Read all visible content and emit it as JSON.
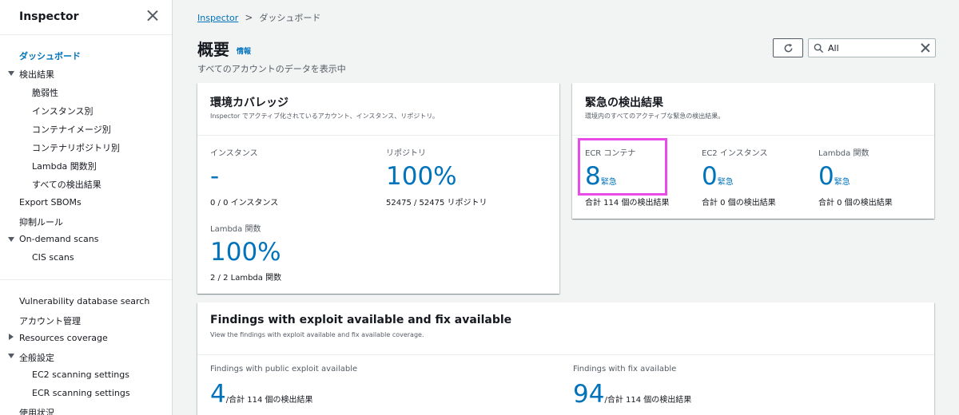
{
  "sidebar": {
    "title": "Inspector",
    "items": [
      {
        "label": "ダッシュボード"
      },
      {
        "label": "検出結果"
      },
      {
        "label": "脆弱性"
      },
      {
        "label": "インスタンス別"
      },
      {
        "label": "コンテナイメージ別"
      },
      {
        "label": "コンテナリポジトリ別"
      },
      {
        "label": "Lambda 関数別"
      },
      {
        "label": "すべての検出結果"
      },
      {
        "label": "Export SBOMs"
      },
      {
        "label": "抑制ルール"
      },
      {
        "label": "On-demand scans"
      },
      {
        "label": "CIS scans"
      },
      {
        "label": "Vulnerability database search"
      },
      {
        "label": "アカウント管理"
      },
      {
        "label": "Resources coverage"
      },
      {
        "label": "全般設定"
      },
      {
        "label": "EC2 scanning settings"
      },
      {
        "label": "ECR scanning settings"
      },
      {
        "label": "使用状況"
      }
    ]
  },
  "breadcrumb": {
    "root": "Inspector",
    "current": "ダッシュボード"
  },
  "header": {
    "title": "概要",
    "info": "情報",
    "description": "すべてのアカウントのデータを表示中"
  },
  "search": {
    "value": "All"
  },
  "coverage": {
    "title": "環境カバレッジ",
    "description": "Inspector でアクティブ化されているアカウント、インスタンス、リポジトリ。",
    "instances": {
      "label": "インスタンス",
      "value": "-",
      "sub": "0 / 0 インスタンス"
    },
    "repositories": {
      "label": "リポジトリ",
      "value": "100%",
      "sub": "52475 / 52475 リポジトリ"
    },
    "lambda": {
      "label": "Lambda 関数",
      "value": "100%",
      "sub": "2 / 2 Lambda 関数"
    }
  },
  "critical": {
    "title": "緊急の検出結果",
    "description": "環境内のすべてのアクティブな緊急の検出結果。",
    "ecr": {
      "label": "ECR コンテナ",
      "value": "8",
      "unit": "緊急",
      "sub": "合計 114 個の検出結果"
    },
    "ec2": {
      "label": "EC2 インスタンス",
      "value": "0",
      "unit": "緊急",
      "sub": "合計 0 個の検出結果"
    },
    "lambda": {
      "label": "Lambda 関数",
      "value": "0",
      "unit": "緊急",
      "sub": "合計 0 個の検出結果"
    }
  },
  "exploit": {
    "title": "Findings with exploit available and fix available",
    "description": "View the findings with exploit available and fix available coverage.",
    "public_exploit": {
      "label": "Findings with public exploit available",
      "value": "4",
      "sub": "/合計 114 個の検出結果"
    },
    "fix": {
      "label": "Findings with fix available",
      "value": "94",
      "sub": "/合計 114 個の検出結果"
    }
  },
  "colors": {
    "link": "#0073bb",
    "highlight": "#e84be8",
    "background": "#f2f3f3"
  }
}
